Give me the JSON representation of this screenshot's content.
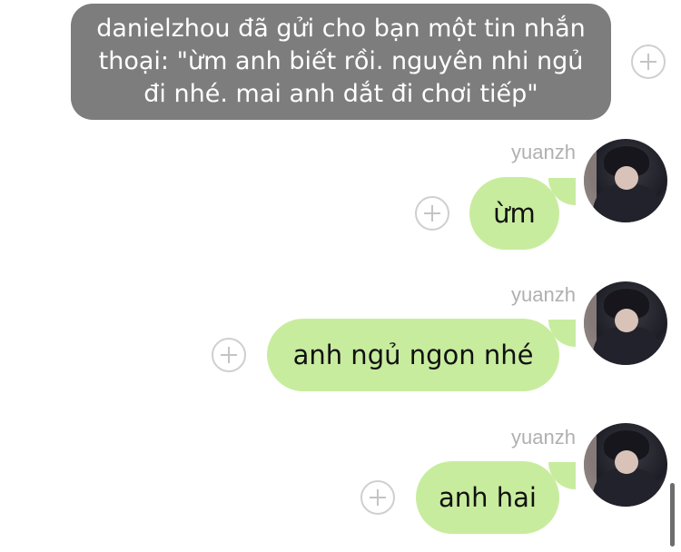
{
  "system_message": {
    "text": "danielzhou đã gửi cho bạn một tin nhắn thoại: \"ừm anh biết rồi. nguyên nhi ngủ đi nhé. mai anh dắt đi chơi tiếp\""
  },
  "messages": [
    {
      "sender": "yuanzh",
      "text": "ừm"
    },
    {
      "sender": "yuanzh",
      "text": "anh ngủ ngon nhé"
    },
    {
      "sender": "yuanzh",
      "text": "anh hai"
    }
  ],
  "colors": {
    "system_bubble": "#7d7d7d",
    "outgoing_bubble": "#c8ec9e",
    "sender_label": "#b0b0b0"
  }
}
